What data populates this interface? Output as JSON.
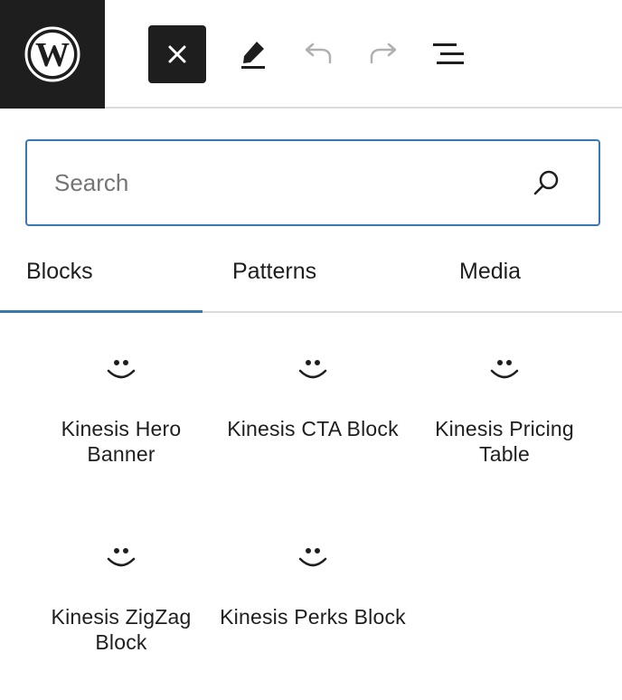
{
  "toolbar": {
    "logo_icon": "wordpress-logo-icon",
    "close_icon": "close-icon",
    "edit_icon": "pencil-icon",
    "undo_icon": "undo-icon",
    "redo_icon": "redo-icon",
    "list_view_icon": "list-view-icon"
  },
  "search": {
    "placeholder": "Search",
    "value": "",
    "icon": "search-icon"
  },
  "tabs": [
    {
      "label": "Blocks",
      "active": true
    },
    {
      "label": "Patterns",
      "active": false
    },
    {
      "label": "Media",
      "active": false
    }
  ],
  "blocks": [
    {
      "label": "Kinesis Hero Banner",
      "icon": "smiley-icon"
    },
    {
      "label": "Kinesis CTA Block",
      "icon": "smiley-icon"
    },
    {
      "label": "Kinesis Pricing Table",
      "icon": "smiley-icon"
    },
    {
      "label": "Kinesis ZigZag Block",
      "icon": "smiley-icon"
    },
    {
      "label": "Kinesis Perks Block",
      "icon": "smiley-icon"
    }
  ],
  "colors": {
    "dark": "#1e1e1e",
    "accent": "#3a78b3",
    "border": "#dcdcde",
    "muted_icon": "#b0b0b0"
  }
}
